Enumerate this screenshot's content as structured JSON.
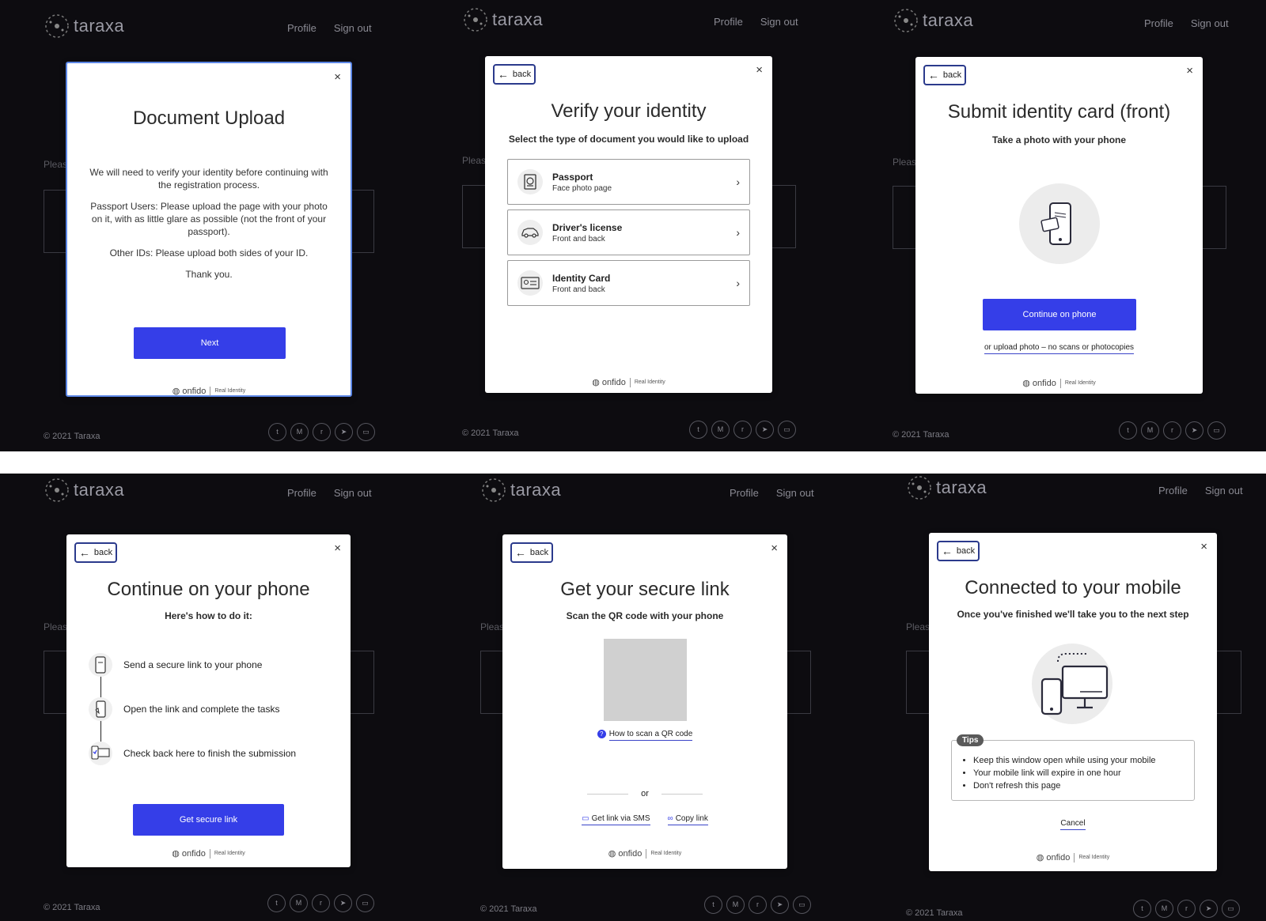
{
  "app": {
    "brand": "taraxa",
    "nav": {
      "profile": "Profile",
      "sign_out": "Sign out"
    },
    "background_text": "Pleas",
    "copyright": "© 2021 Taraxa",
    "socials": [
      "twitter-icon",
      "medium-icon",
      "reddit-icon",
      "telegram-icon",
      "discord-icon"
    ]
  },
  "common": {
    "back": "back",
    "close": "×",
    "onfido": "onfido",
    "real_identity": "Real Identity"
  },
  "screen1": {
    "title": "Document Upload",
    "paragraphs": [
      "We will need to verify your identity before continuing with the registration process.",
      "Passport Users: Please upload the page with your photo on it, with as little glare as possible (not the front of your passport).",
      "Other IDs: Please upload both sides of your ID.",
      "Thank you."
    ],
    "next": "Next"
  },
  "screen2": {
    "title": "Verify your identity",
    "subtitle": "Select the type of document you would like to upload",
    "options": [
      {
        "name": "Passport",
        "sub": "Face photo page"
      },
      {
        "name": "Driver's license",
        "sub": "Front and back"
      },
      {
        "name": "Identity Card",
        "sub": "Front and back"
      }
    ]
  },
  "screen3": {
    "title": "Submit identity card (front)",
    "subtitle": "Take a photo with your phone",
    "continue": "Continue on phone",
    "upload_link": "or upload photo – no scans or photocopies"
  },
  "screen4": {
    "title": "Continue on your phone",
    "subtitle": "Here's how to do it:",
    "steps": [
      "Send a secure link to your phone",
      "Open the link and complete the tasks",
      "Check back here to finish the submission"
    ],
    "button": "Get secure link"
  },
  "screen5": {
    "title": "Get your secure link",
    "subtitle": "Scan the QR code with your phone",
    "how_to": "How to scan a QR code",
    "or": "or",
    "sms": "Get link via SMS",
    "copy": "Copy link"
  },
  "screen6": {
    "title": "Connected to your mobile",
    "subtitle": "Once you've finished we'll take you to the next step",
    "tips_label": "Tips",
    "tips": [
      "Keep this window open while using your mobile",
      "Your mobile link will expire in one hour",
      "Don't refresh this page"
    ],
    "cancel": "Cancel"
  },
  "colors": {
    "page_bg": "#0d0c10",
    "primary": "#353ee8",
    "back_border": "#2b3a8c",
    "link_underline": "#3a44c8"
  }
}
